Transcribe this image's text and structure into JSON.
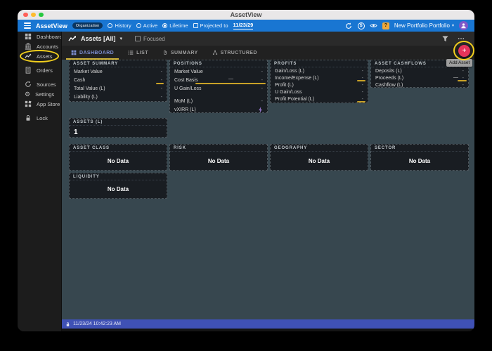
{
  "titlebar": {
    "title": "AssetView"
  },
  "toolbar": {
    "app_name": "AssetView",
    "org_badge": "Organization",
    "filters": {
      "history": "History",
      "active": "Active",
      "lifetime": "Lifetime",
      "selected": "Lifetime"
    },
    "projected": {
      "label": "Projected to",
      "date": "11/23/29",
      "checked": false
    },
    "portfolio": "New Portfolio Portfolio"
  },
  "icons": {
    "currency": "$",
    "help": "?",
    "caret": "▾",
    "more": "⋯",
    "add": "+",
    "gear": "⚙"
  },
  "sidebar": {
    "items": [
      {
        "label": "Dashboard",
        "icon": "dashboard-grid-icon"
      },
      {
        "label": "Accounts",
        "icon": "bank-icon"
      },
      {
        "label": "Assets",
        "icon": "trend-icon",
        "highlighted": true
      },
      {
        "label": "Orders",
        "icon": "receipt-icon"
      },
      {
        "label": "Sources",
        "icon": "sync-icon"
      },
      {
        "label": "Settings",
        "icon": "gear-icon"
      },
      {
        "label": "App Store",
        "icon": "apps-icon"
      },
      {
        "label": "Lock",
        "icon": "lock-icon"
      }
    ]
  },
  "main": {
    "header": {
      "title": "Assets [All]",
      "focused": "Focused"
    },
    "tabs": [
      {
        "label": "DASHBOARD",
        "active": true
      },
      {
        "label": "LIST",
        "active": false
      },
      {
        "label": "SUMMARY",
        "active": false
      },
      {
        "label": "STRUCTURED",
        "active": false
      }
    ],
    "fab": {
      "tooltip": "Add Asset"
    }
  },
  "cards": {
    "asset_summary": {
      "title": "ASSET SUMMARY",
      "rows": [
        {
          "label": "Market Value",
          "value": "-"
        },
        {
          "label": "Cash",
          "value": "-",
          "underlined": true
        },
        {
          "label": "Total Value (L)",
          "value": "-"
        },
        {
          "label": "Liability (L)",
          "value": "-"
        }
      ]
    },
    "positions": {
      "title": "POSITIONS",
      "rows": [
        {
          "label": "Market Value",
          "value": "-"
        },
        {
          "label": "Cost Basis",
          "value": "-",
          "dash": "—",
          "underlined": true
        },
        {
          "label": "U Gain/Loss",
          "value": "-"
        },
        {
          "label": "MoM (L)",
          "value": "-"
        },
        {
          "label": "vXIRR (L)",
          "value": "",
          "value_icon": "bolt-icon"
        }
      ]
    },
    "profits": {
      "title": "PROFITS",
      "rows": [
        {
          "label": "Gain/Loss (L)",
          "value": "-"
        },
        {
          "label": "Income/Expense (L)",
          "value": "-",
          "underlined": true
        },
        {
          "label": "Profit (L)",
          "value": "-"
        },
        {
          "label": "U Gain/Loss",
          "value": "-"
        },
        {
          "label": "Profit Potential (L)",
          "value": "-",
          "underlined": true
        }
      ]
    },
    "asset_cashflows": {
      "title": "ASSET CASHFLOWS",
      "rows": [
        {
          "label": "Deposits (L)",
          "value": "-"
        },
        {
          "label": "Proceeds (L)",
          "value": "-",
          "dash": "—",
          "underlined": true
        },
        {
          "label": "Cashflow (L)",
          "value": "-"
        }
      ]
    },
    "assets_count": {
      "title": "ASSETS (L)",
      "value": "1"
    },
    "no_data_label": "No Data",
    "breakdown_cards": [
      {
        "title": "ASSET CLASS"
      },
      {
        "title": "RISK"
      },
      {
        "title": "GEOGRAPHY"
      },
      {
        "title": "SECTOR"
      },
      {
        "title": "LIQUIDITY"
      }
    ]
  },
  "statusbar": {
    "timestamp": "11/23/24 10:42:23 AM"
  },
  "colors": {
    "toolbar_blue": "#1976d2",
    "statusbar_indigo": "#3f51b5",
    "content_bg": "#37474f",
    "card_bg": "#191d22",
    "accent_yellow": "#c9a227",
    "active_tab_indigo": "#7e8fd4",
    "fab_pink": "#e5345a",
    "annotation_yellow": "#f2cf1d",
    "avatar_purple": "#7d57c8",
    "help_orange": "#f0a93a"
  }
}
